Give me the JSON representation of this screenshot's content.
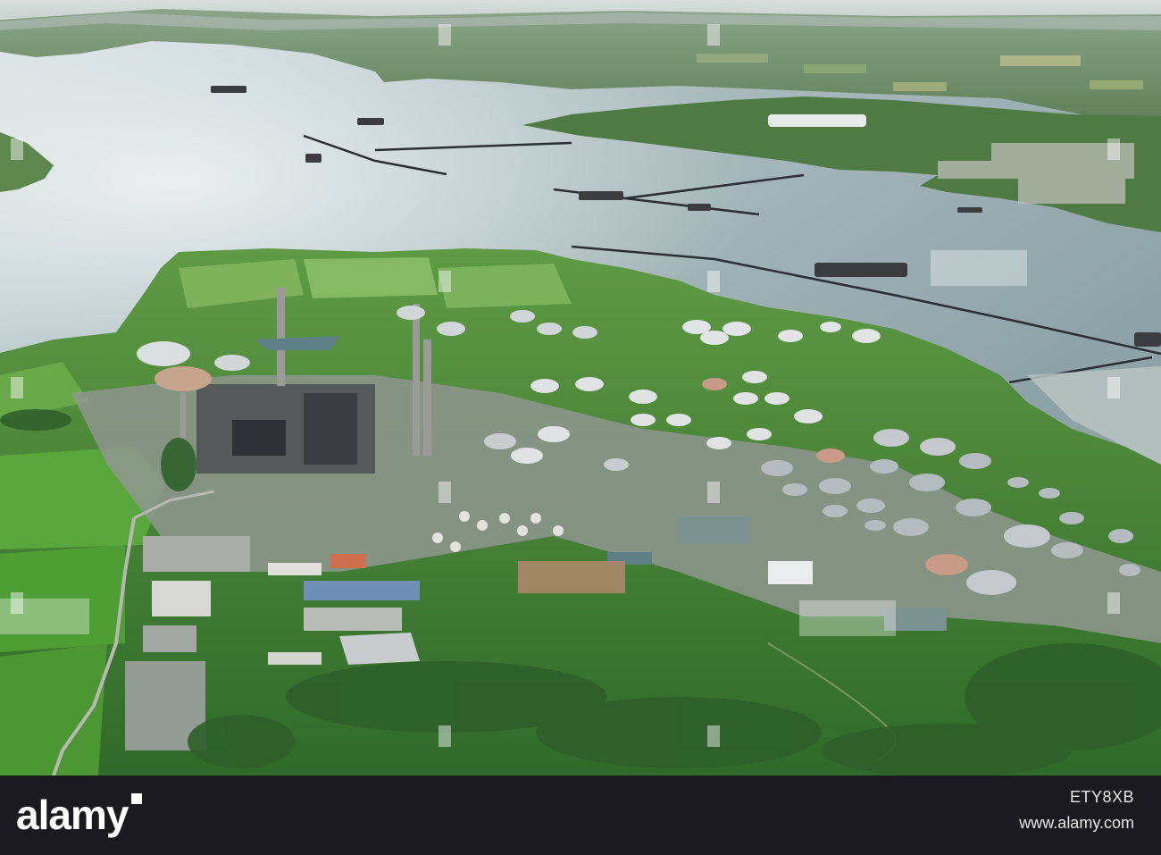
{
  "photo": {
    "subject": "aerial-refinery",
    "colors": {
      "water": "#9fb3b8",
      "water_glare": "#d9e3e3",
      "land_far": "#6f8f6a",
      "field": "#55a23c",
      "tank": "#c9ced0",
      "haze": "#cfd8d6"
    }
  },
  "watermark": {
    "logo": "alamy",
    "image_id": "ETY8XB",
    "url": "www.alamy.com"
  }
}
